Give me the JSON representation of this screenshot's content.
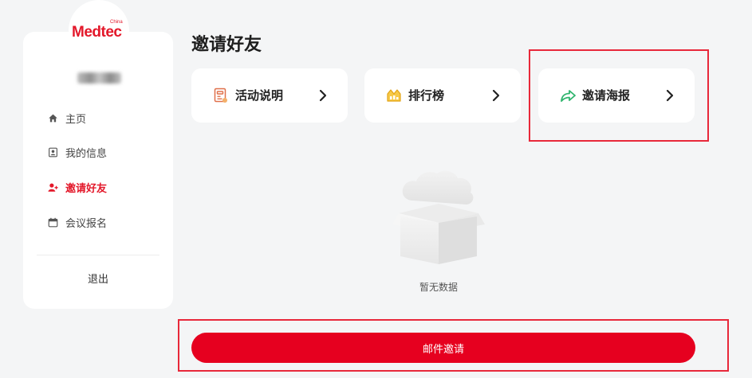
{
  "brand": {
    "logo_text": "Medtec",
    "logo_superscript": "China",
    "accent_color": "#e6001f"
  },
  "sidebar": {
    "items": [
      {
        "label": "主页",
        "icon": "home-icon"
      },
      {
        "label": "我的信息",
        "icon": "user-card-icon"
      },
      {
        "label": "邀请好友",
        "icon": "invite-friends-icon",
        "active": true
      },
      {
        "label": "会议报名",
        "icon": "calendar-icon"
      }
    ],
    "logout_label": "退出"
  },
  "main": {
    "title": "邀请好友",
    "cards": [
      {
        "label": "活动说明",
        "icon": "activity-doc-icon"
      },
      {
        "label": "排行榜",
        "icon": "ranking-icon"
      },
      {
        "label": "邀请海报",
        "icon": "share-arrow-icon"
      }
    ],
    "empty_text": "暂无数据",
    "mail_invite_label": "邮件邀请"
  }
}
